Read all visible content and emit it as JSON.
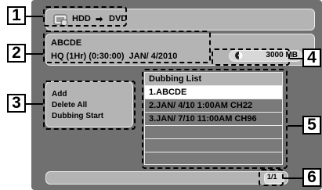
{
  "title_bar": {
    "source": "HDD",
    "arrow": "➡",
    "target": "DVD",
    "icon": "hdd-to-dvd-icon"
  },
  "info": {
    "title": "ABCDE",
    "details": "HQ (1Hr) (0:30:00)  JAN/ 4/2010",
    "space": "3000 MB",
    "disc_icon": "disc-icon"
  },
  "menu": {
    "items": [
      "Add",
      "Delete All",
      "Dubbing Start"
    ]
  },
  "dubbing_list": {
    "header": "Dubbing List",
    "items": [
      "1.ABCDE",
      "2.JAN/ 4/10  1:00AM CH22",
      "3.JAN/ 7/10 11:00AM CH96",
      "",
      "",
      ""
    ]
  },
  "page_indicator": "1/1",
  "callouts": [
    "1",
    "2",
    "3",
    "4",
    "5",
    "6"
  ]
}
